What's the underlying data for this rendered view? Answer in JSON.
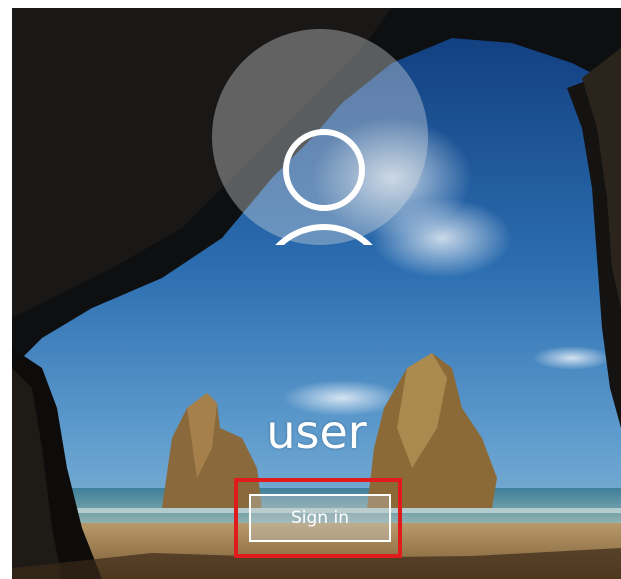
{
  "login": {
    "username": "user",
    "sign_in_label": "Sign in",
    "avatar_icon": "user-icon"
  },
  "colors": {
    "highlight": "#e01b1b",
    "text": "#ffffff"
  }
}
